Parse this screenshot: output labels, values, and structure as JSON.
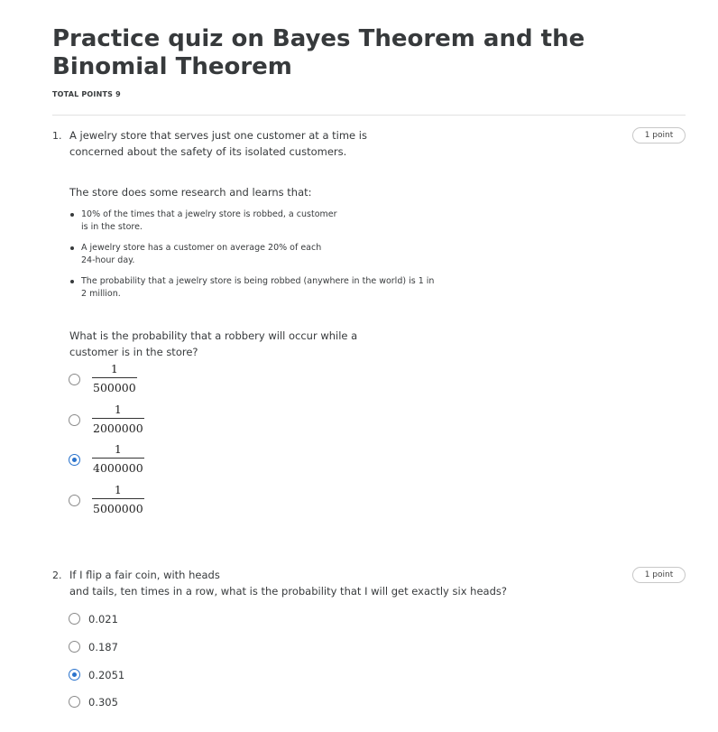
{
  "quiz": {
    "title": "Practice quiz on Bayes Theorem and the Binomial Theorem",
    "total_points": "TOTAL POINTS 9"
  },
  "q1": {
    "number": "1.",
    "points": "1 point",
    "intro_line1": "A jewelry store that serves just one customer at a time is",
    "intro_line2": "concerned about the safety of its isolated customers.",
    "research_intro": "The store does some research and learns that:",
    "facts": [
      {
        "line1": "10% of the times that a jewelry store is robbed, a customer",
        "line2": "is in the store."
      },
      {
        "line1": "A jewelry store has a customer on average 20% of each",
        "line2": "24-hour day."
      },
      {
        "line1": "The probability that a jewelry store is being robbed (anywhere in the world) is 1 in",
        "line2": "2 million."
      }
    ],
    "question_line1": "What is the probability that a robbery will occur while a",
    "question_line2": "customer is in the store?",
    "options": [
      {
        "numerator": "1",
        "denominator": "500000",
        "selected": false
      },
      {
        "numerator": "1",
        "denominator": "2000000",
        "selected": false
      },
      {
        "numerator": "1",
        "denominator": "4000000",
        "selected": true
      },
      {
        "numerator": "1",
        "denominator": "5000000",
        "selected": false
      }
    ]
  },
  "q2": {
    "number": "2.",
    "points": "1 point",
    "question_line1": "If I flip a fair coin, with heads",
    "question_line2": "and tails, ten times in a row, what is the probability that I will get exactly six heads?",
    "options": [
      {
        "label": "0.021",
        "selected": false
      },
      {
        "label": "0.187",
        "selected": false
      },
      {
        "label": "0.2051",
        "selected": true
      },
      {
        "label": "0.305",
        "selected": false
      }
    ]
  },
  "colors": {
    "accent": "#2a73cc",
    "text": "#373a3c",
    "divider": "#e1e1e1"
  }
}
